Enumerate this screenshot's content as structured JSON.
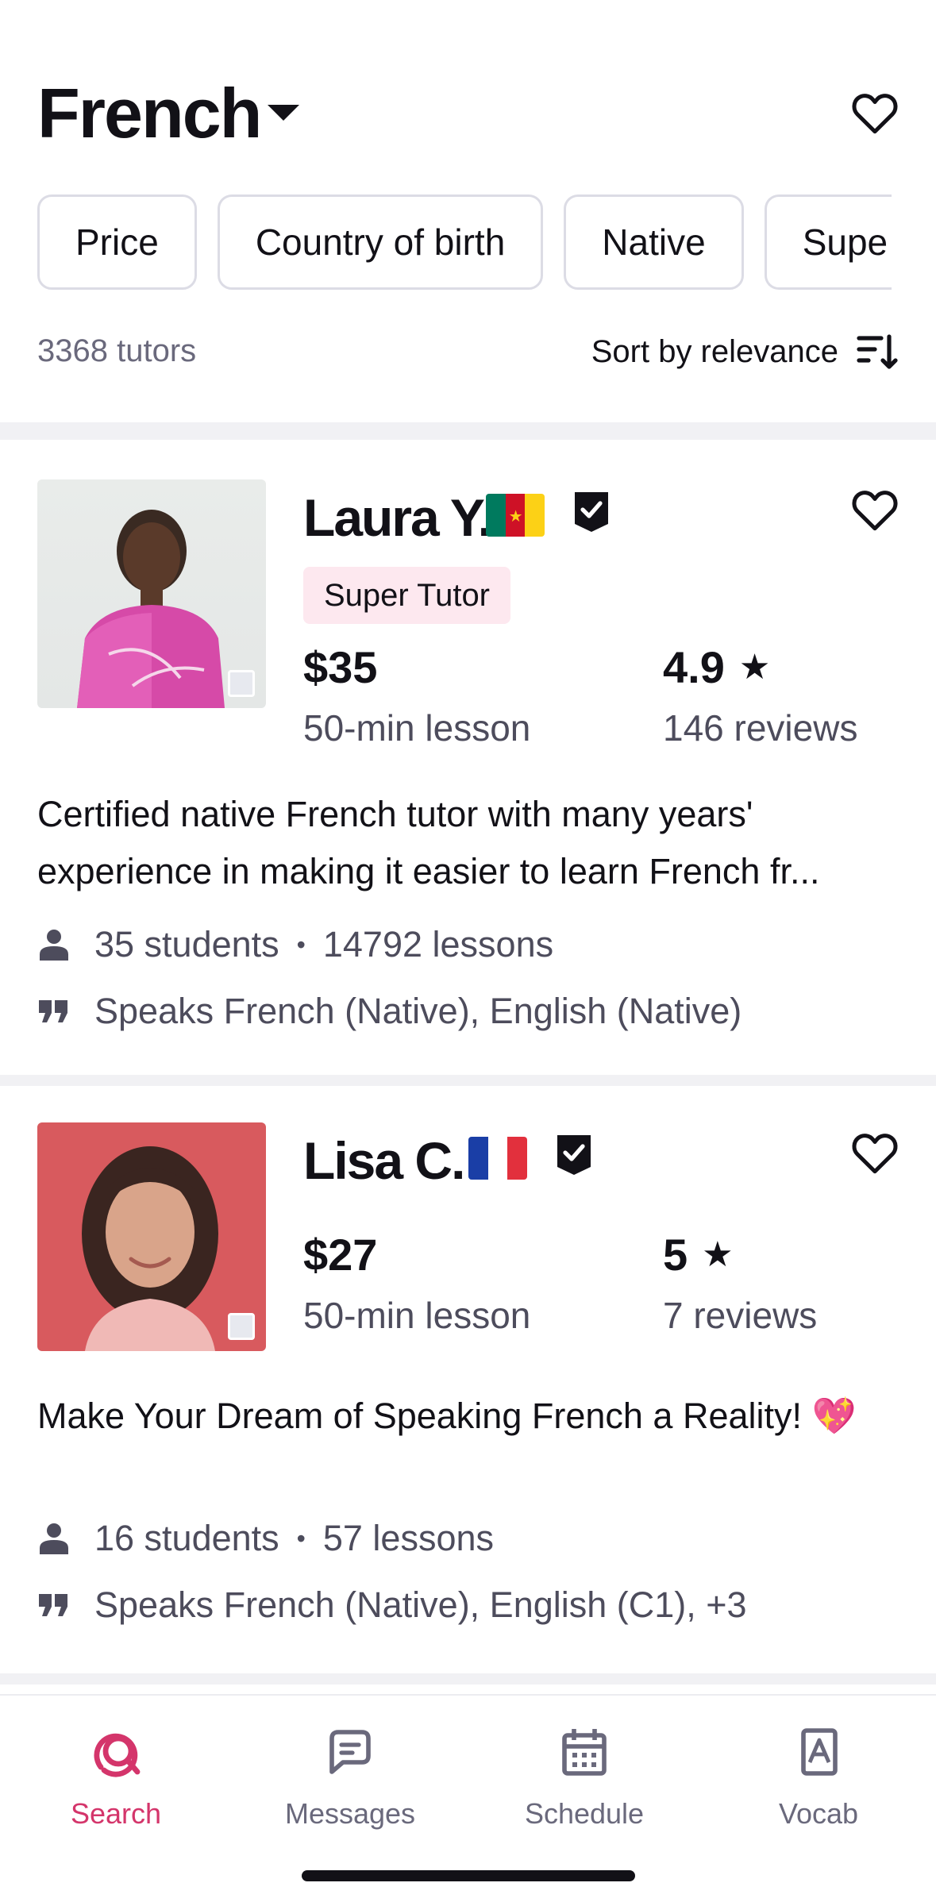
{
  "header": {
    "language": "French"
  },
  "filters": [
    "Price",
    "Country of birth",
    "Native",
    "Supe"
  ],
  "summary": {
    "count": "3368 tutors",
    "sort_label": "Sort by relevance"
  },
  "tutors": [
    {
      "name": "Laura Y.",
      "flag": "cameroon-flag",
      "badge": "Super Tutor",
      "price": "$35",
      "price_sub": "50-min lesson",
      "rating": "4.9",
      "star": "★",
      "reviews": "146 reviews",
      "headline": "Certified native French tutor with many years' experience in making it easier to learn French fr...",
      "students": "35 students",
      "lessons": "14792 lessons",
      "speaks": "Speaks French (Native), English (Native)"
    },
    {
      "name": "Lisa C.",
      "flag": "france-flag",
      "badge": "",
      "price": "$27",
      "price_sub": "50-min lesson",
      "rating": "5",
      "star": "★",
      "reviews": "7 reviews",
      "headline": "Make Your Dream of Speaking French a Reality! 💖",
      "students": "16 students",
      "lessons": "57 lessons",
      "speaks": "Speaks French (Native), English (C1), +3"
    }
  ],
  "tabs": [
    {
      "label": "Search",
      "icon": "search-icon",
      "active": true
    },
    {
      "label": "Messages",
      "icon": "messages-icon",
      "active": false
    },
    {
      "label": "Schedule",
      "icon": "calendar-icon",
      "active": false
    },
    {
      "label": "Vocab",
      "icon": "vocab-icon",
      "active": false
    }
  ],
  "colors": {
    "accent": "#d4356b",
    "badge_bg": "#fde8ef",
    "text": "#121117",
    "muted": "#6a697c"
  }
}
